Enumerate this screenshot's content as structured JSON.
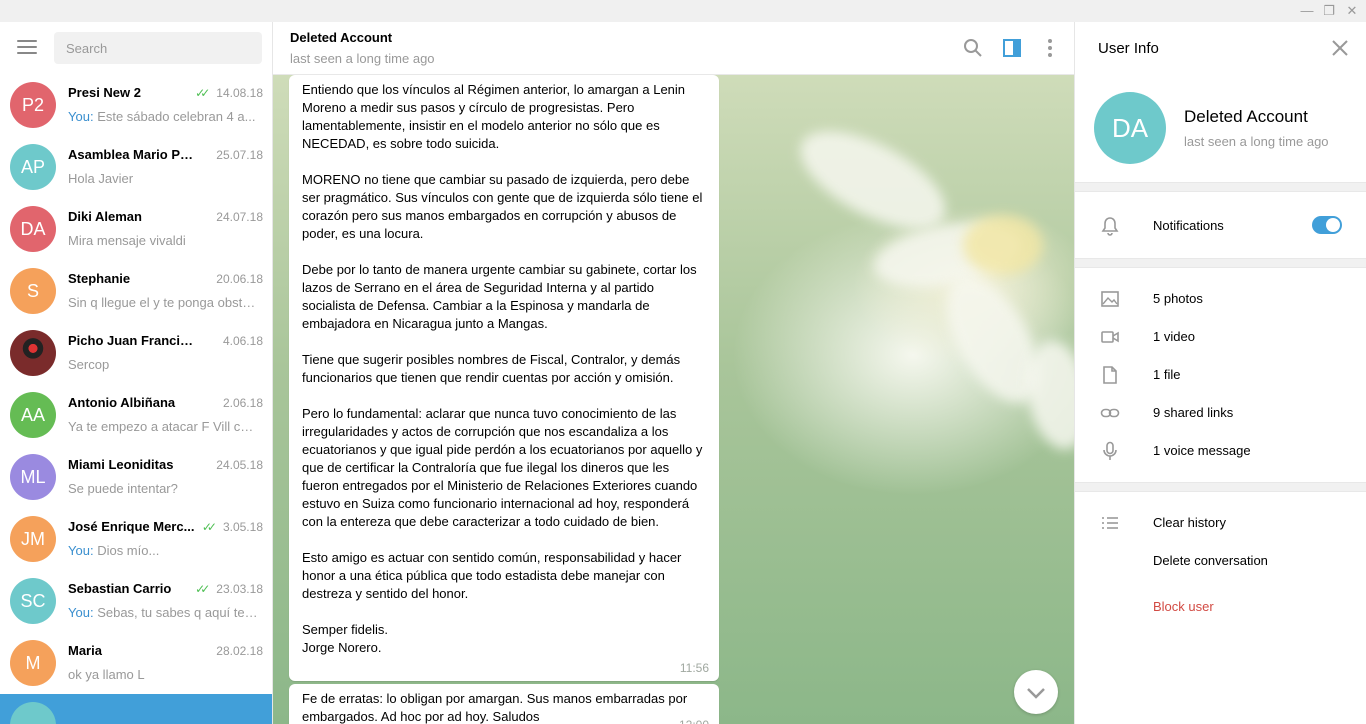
{
  "window": {
    "minimize": "—",
    "maximize": "❐",
    "close": "✕"
  },
  "sidebar": {
    "search_placeholder": "Search",
    "dialogs": [
      {
        "initials": "P2",
        "color": "#e1656d",
        "name": "Presi New 2",
        "date": "14.08.18",
        "read": true,
        "you": true,
        "message": "Este sábado celebran 4 a..."
      },
      {
        "initials": "AP",
        "color": "#6ec9cb",
        "name": "Asamblea Mario Paz...",
        "date": "25.07.18",
        "read": false,
        "you": false,
        "message": "Hola Javier"
      },
      {
        "initials": "DA",
        "color": "#e1656d",
        "name": "Diki Aleman",
        "date": "24.07.18",
        "read": false,
        "you": false,
        "message": "Mira mensaje vivaldi"
      },
      {
        "initials": "S",
        "color": "#f5a15b",
        "name": "Stephanie",
        "date": "20.06.18",
        "read": false,
        "you": false,
        "message": "Sin q llegue el y te ponga obstá..."
      },
      {
        "initials": "",
        "color": "#7a2b2b",
        "name": "Picho Juan Francisco",
        "date": "4.06.18",
        "read": false,
        "you": false,
        "message": "Sercop",
        "photo": true
      },
      {
        "initials": "AA",
        "color": "#65bc54",
        "name": "Antonio Albiñana",
        "date": "2.06.18",
        "read": false,
        "you": false,
        "message": "Ya te empezo a atacar F Vill con..."
      },
      {
        "initials": "ML",
        "color": "#9a8ae0",
        "name": "Miami Leoniditas",
        "date": "24.05.18",
        "read": false,
        "you": false,
        "message": "Se puede intentar?"
      },
      {
        "initials": "JM",
        "color": "#f5a15b",
        "name": "José Enrique Merc...",
        "date": "3.05.18",
        "read": true,
        "you": true,
        "message": "Dios mío..."
      },
      {
        "initials": "SC",
        "color": "#6ec9cb",
        "name": "Sebastian Carrio",
        "date": "23.03.18",
        "read": true,
        "you": true,
        "message": "Sebas, tu sabes q aquí te q..."
      },
      {
        "initials": "M",
        "color": "#f5a15b",
        "name": "Maria",
        "date": "28.02.18",
        "read": false,
        "you": false,
        "message": "ok ya llamo L"
      }
    ],
    "you_label": "You:"
  },
  "chat": {
    "title": "Deleted Account",
    "status": "last seen a long time ago",
    "messages": [
      {
        "paragraphs": [
          "Entiendo que los vínculos al Régimen anterior, lo amargan a Lenin Moreno a medir sus pasos y círculo de progresistas. Pero lamentablemente,  insistir en el modelo anterior no sólo que es NECEDAD, es sobre todo suicida.",
          "MORENO no tiene que cambiar su pasado de izquierda, pero debe ser pragmático.  Sus vínculos con gente que de izquierda sólo tiene el corazón pero sus manos embargados en corrupción y abusos de poder, es una locura.",
          "Debe por lo tanto de manera urgente cambiar su gabinete, cortar los lazos de Serrano en el área de Seguridad Interna y al partido socialista de Defensa. Cambiar a la Espinosa y mandarla de embajadora en Nicaragua junto a Mangas.",
          "Tiene que sugerir posibles nombres de Fiscal, Contralor, y demás funcionarios que tienen que rendir cuentas por acción y omisión.",
          "Pero lo fundamental: aclarar que nunca tuvo conocimiento de las irregularidades y actos de corrupción que nos escandaliza a los ecuatorianos y que igual pide perdón a los ecuatorianos por aquello y que de certificar la Contraloría que fue ilegal los dineros que les fueron entregados por el Ministerio de Relaciones Exteriores cuando estuvo en Suiza como funcionario internacional ad hoy, responderá con la entereza que debe caracterizar a todo cuidado de bien.",
          "Esto amigo es actuar con sentido común,  responsabilidad y hacer honor a una ética pública que todo estadista debe manejar con destreza y sentido del honor.",
          "Semper fidelis.\nJorge Norero."
        ],
        "time": "11:56"
      },
      {
        "paragraphs": [
          "Fe de erratas: lo obligan por amargan. Sus manos embarradas por embargados. Ad hoc por ad hoy. Saludos"
        ],
        "time": "12:00"
      }
    ]
  },
  "info": {
    "title": "User Info",
    "initials": "DA",
    "avatar_color": "#6ec9cb",
    "name": "Deleted Account",
    "status": "last seen a long time ago",
    "notifications_label": "Notifications",
    "notifications_on": true,
    "media": {
      "photos": "5 photos",
      "video": "1 video",
      "file": "1 file",
      "links": "9 shared links",
      "voice": "1 voice message"
    },
    "actions": {
      "clear": "Clear history",
      "delete": "Delete conversation",
      "block": "Block user"
    },
    "accent": "#419fd9",
    "danger": "#d24a43"
  }
}
